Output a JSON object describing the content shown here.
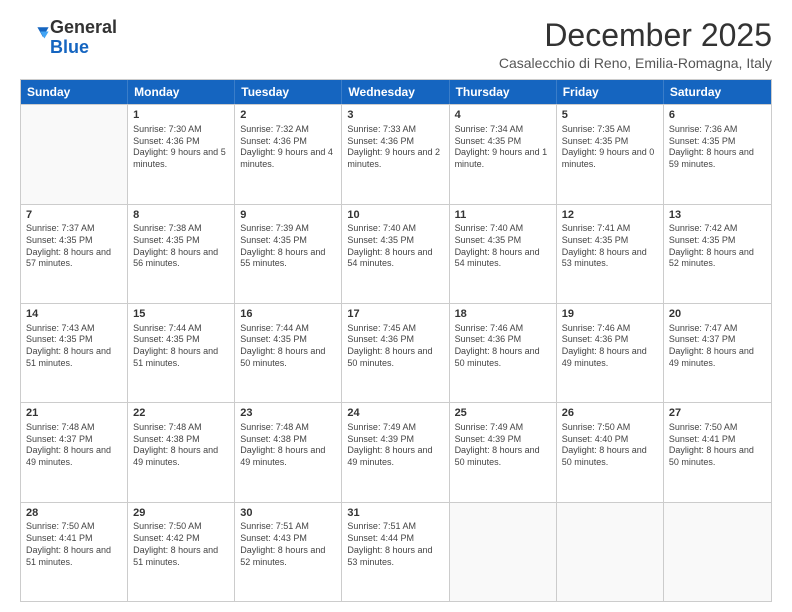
{
  "logo": {
    "general": "General",
    "blue": "Blue"
  },
  "header": {
    "month": "December 2025",
    "location": "Casalecchio di Reno, Emilia-Romagna, Italy"
  },
  "days_of_week": [
    "Sunday",
    "Monday",
    "Tuesday",
    "Wednesday",
    "Thursday",
    "Friday",
    "Saturday"
  ],
  "weeks": [
    [
      {
        "day": "",
        "sunrise": "",
        "sunset": "",
        "daylight": ""
      },
      {
        "day": "1",
        "sunrise": "Sunrise: 7:30 AM",
        "sunset": "Sunset: 4:36 PM",
        "daylight": "Daylight: 9 hours and 5 minutes."
      },
      {
        "day": "2",
        "sunrise": "Sunrise: 7:32 AM",
        "sunset": "Sunset: 4:36 PM",
        "daylight": "Daylight: 9 hours and 4 minutes."
      },
      {
        "day": "3",
        "sunrise": "Sunrise: 7:33 AM",
        "sunset": "Sunset: 4:36 PM",
        "daylight": "Daylight: 9 hours and 2 minutes."
      },
      {
        "day": "4",
        "sunrise": "Sunrise: 7:34 AM",
        "sunset": "Sunset: 4:35 PM",
        "daylight": "Daylight: 9 hours and 1 minute."
      },
      {
        "day": "5",
        "sunrise": "Sunrise: 7:35 AM",
        "sunset": "Sunset: 4:35 PM",
        "daylight": "Daylight: 9 hours and 0 minutes."
      },
      {
        "day": "6",
        "sunrise": "Sunrise: 7:36 AM",
        "sunset": "Sunset: 4:35 PM",
        "daylight": "Daylight: 8 hours and 59 minutes."
      }
    ],
    [
      {
        "day": "7",
        "sunrise": "Sunrise: 7:37 AM",
        "sunset": "Sunset: 4:35 PM",
        "daylight": "Daylight: 8 hours and 57 minutes."
      },
      {
        "day": "8",
        "sunrise": "Sunrise: 7:38 AM",
        "sunset": "Sunset: 4:35 PM",
        "daylight": "Daylight: 8 hours and 56 minutes."
      },
      {
        "day": "9",
        "sunrise": "Sunrise: 7:39 AM",
        "sunset": "Sunset: 4:35 PM",
        "daylight": "Daylight: 8 hours and 55 minutes."
      },
      {
        "day": "10",
        "sunrise": "Sunrise: 7:40 AM",
        "sunset": "Sunset: 4:35 PM",
        "daylight": "Daylight: 8 hours and 54 minutes."
      },
      {
        "day": "11",
        "sunrise": "Sunrise: 7:40 AM",
        "sunset": "Sunset: 4:35 PM",
        "daylight": "Daylight: 8 hours and 54 minutes."
      },
      {
        "day": "12",
        "sunrise": "Sunrise: 7:41 AM",
        "sunset": "Sunset: 4:35 PM",
        "daylight": "Daylight: 8 hours and 53 minutes."
      },
      {
        "day": "13",
        "sunrise": "Sunrise: 7:42 AM",
        "sunset": "Sunset: 4:35 PM",
        "daylight": "Daylight: 8 hours and 52 minutes."
      }
    ],
    [
      {
        "day": "14",
        "sunrise": "Sunrise: 7:43 AM",
        "sunset": "Sunset: 4:35 PM",
        "daylight": "Daylight: 8 hours and 51 minutes."
      },
      {
        "day": "15",
        "sunrise": "Sunrise: 7:44 AM",
        "sunset": "Sunset: 4:35 PM",
        "daylight": "Daylight: 8 hours and 51 minutes."
      },
      {
        "day": "16",
        "sunrise": "Sunrise: 7:44 AM",
        "sunset": "Sunset: 4:35 PM",
        "daylight": "Daylight: 8 hours and 50 minutes."
      },
      {
        "day": "17",
        "sunrise": "Sunrise: 7:45 AM",
        "sunset": "Sunset: 4:36 PM",
        "daylight": "Daylight: 8 hours and 50 minutes."
      },
      {
        "day": "18",
        "sunrise": "Sunrise: 7:46 AM",
        "sunset": "Sunset: 4:36 PM",
        "daylight": "Daylight: 8 hours and 50 minutes."
      },
      {
        "day": "19",
        "sunrise": "Sunrise: 7:46 AM",
        "sunset": "Sunset: 4:36 PM",
        "daylight": "Daylight: 8 hours and 49 minutes."
      },
      {
        "day": "20",
        "sunrise": "Sunrise: 7:47 AM",
        "sunset": "Sunset: 4:37 PM",
        "daylight": "Daylight: 8 hours and 49 minutes."
      }
    ],
    [
      {
        "day": "21",
        "sunrise": "Sunrise: 7:48 AM",
        "sunset": "Sunset: 4:37 PM",
        "daylight": "Daylight: 8 hours and 49 minutes."
      },
      {
        "day": "22",
        "sunrise": "Sunrise: 7:48 AM",
        "sunset": "Sunset: 4:38 PM",
        "daylight": "Daylight: 8 hours and 49 minutes."
      },
      {
        "day": "23",
        "sunrise": "Sunrise: 7:48 AM",
        "sunset": "Sunset: 4:38 PM",
        "daylight": "Daylight: 8 hours and 49 minutes."
      },
      {
        "day": "24",
        "sunrise": "Sunrise: 7:49 AM",
        "sunset": "Sunset: 4:39 PM",
        "daylight": "Daylight: 8 hours and 49 minutes."
      },
      {
        "day": "25",
        "sunrise": "Sunrise: 7:49 AM",
        "sunset": "Sunset: 4:39 PM",
        "daylight": "Daylight: 8 hours and 50 minutes."
      },
      {
        "day": "26",
        "sunrise": "Sunrise: 7:50 AM",
        "sunset": "Sunset: 4:40 PM",
        "daylight": "Daylight: 8 hours and 50 minutes."
      },
      {
        "day": "27",
        "sunrise": "Sunrise: 7:50 AM",
        "sunset": "Sunset: 4:41 PM",
        "daylight": "Daylight: 8 hours and 50 minutes."
      }
    ],
    [
      {
        "day": "28",
        "sunrise": "Sunrise: 7:50 AM",
        "sunset": "Sunset: 4:41 PM",
        "daylight": "Daylight: 8 hours and 51 minutes."
      },
      {
        "day": "29",
        "sunrise": "Sunrise: 7:50 AM",
        "sunset": "Sunset: 4:42 PM",
        "daylight": "Daylight: 8 hours and 51 minutes."
      },
      {
        "day": "30",
        "sunrise": "Sunrise: 7:51 AM",
        "sunset": "Sunset: 4:43 PM",
        "daylight": "Daylight: 8 hours and 52 minutes."
      },
      {
        "day": "31",
        "sunrise": "Sunrise: 7:51 AM",
        "sunset": "Sunset: 4:44 PM",
        "daylight": "Daylight: 8 hours and 53 minutes."
      },
      {
        "day": "",
        "sunrise": "",
        "sunset": "",
        "daylight": ""
      },
      {
        "day": "",
        "sunrise": "",
        "sunset": "",
        "daylight": ""
      },
      {
        "day": "",
        "sunrise": "",
        "sunset": "",
        "daylight": ""
      }
    ]
  ]
}
